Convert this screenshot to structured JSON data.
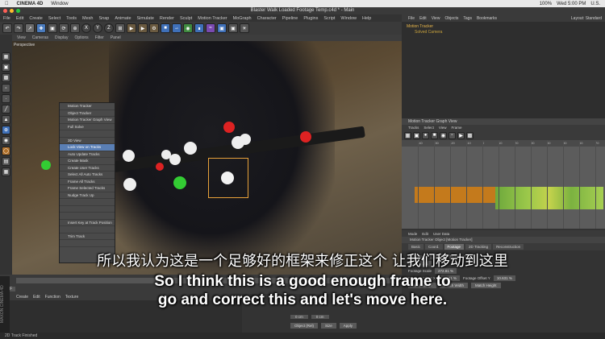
{
  "mac_menubar": {
    "app": "CINEMA 4D",
    "window_menu": "Window",
    "status_right": "100%",
    "datetime": "Wed 5:00 PM",
    "user": "U.S."
  },
  "window_title": "Blaster Walk Loaded Footage Temp.c4d * - Main",
  "menubar": [
    "File",
    "Edit",
    "Create",
    "Select",
    "Tools",
    "Mesh",
    "Snap",
    "Animate",
    "Simulate",
    "Render",
    "Sculpt",
    "Motion Tracker",
    "MoGraph",
    "Character",
    "Pipeline",
    "Plugins",
    "Script",
    "Window",
    "Help"
  ],
  "toolbar": {
    "axis_x": "X",
    "axis_y": "Y",
    "axis_z": "Z"
  },
  "viewport": {
    "menu": [
      "View",
      "Cameras",
      "Display",
      "Options",
      "Filter",
      "Panel"
    ],
    "label": "Perspective"
  },
  "context_menu": [
    {
      "label": "Motion Tracker",
      "state": "normal"
    },
    {
      "label": "Object Tracker",
      "state": "normal"
    },
    {
      "label": "Motion Tracker Graph View",
      "state": "normal"
    },
    {
      "label": "Full Solve",
      "state": "normal"
    },
    {
      "label": "",
      "state": "normal"
    },
    {
      "label": "3D View",
      "state": "normal"
    },
    {
      "label": "Lock View on Tracks",
      "state": "highlight"
    },
    {
      "label": "Auto Update Tracks",
      "state": "normal"
    },
    {
      "label": "Create Mask",
      "state": "normal"
    },
    {
      "label": "Create User Tracks",
      "state": "normal"
    },
    {
      "label": "Select All Auto Tracks",
      "state": "normal"
    },
    {
      "label": "Frame All Tracks",
      "state": "normal"
    },
    {
      "label": "Frame Selected Tracks",
      "state": "normal"
    },
    {
      "label": "Nudge Track Up",
      "state": "normal"
    },
    {
      "label": "",
      "state": "disabled"
    },
    {
      "label": "",
      "state": "disabled"
    },
    {
      "label": "",
      "state": "disabled"
    },
    {
      "label": "Insert Key at Track Position",
      "state": "normal"
    },
    {
      "label": "",
      "state": "normal"
    },
    {
      "label": "Trim Track",
      "state": "normal"
    },
    {
      "label": "",
      "state": "disabled"
    }
  ],
  "objects_panel": {
    "menu": [
      "File",
      "Edit",
      "View",
      "Objects",
      "Tags",
      "Bookmarks"
    ],
    "items": [
      {
        "name": "Motion Tracker",
        "level": 0
      },
      {
        "name": "Solved Camera",
        "level": 1
      }
    ],
    "layout_label": "Layout:",
    "layout_value": "Standard"
  },
  "graph_view": {
    "title": "Motion Tracker Graph View",
    "menu": [
      "Tracks",
      "Select",
      "View",
      "Frame"
    ],
    "ruler": [
      "-40",
      "-30",
      "-20",
      "-10",
      "0",
      "10",
      "20",
      "30",
      "40",
      "50",
      "60",
      "70"
    ]
  },
  "attributes": {
    "menu": [
      "Mode",
      "Edit",
      "User Data"
    ],
    "title": "Motion Tracker Object [Motion Tracker]",
    "tabs": [
      "Basic",
      "Coord.",
      "Footage",
      "2D Tracking",
      "Reconstruction"
    ],
    "active_tab": "Footage",
    "rows": [
      {
        "label": "Film Aspect",
        "value": "1.778",
        "extra": "(Render: 1.778)"
      },
      {
        "label": "Start",
        "value": "201"
      },
      {
        "label": "Footage Scale",
        "value": "272.81 %"
      },
      {
        "label": "Footage Offset X",
        "value": "-0.101 %",
        "label2": "Footage Offset Y",
        "value2": "10.631 %"
      }
    ],
    "buttons": [
      "Full Footage",
      "Match Width",
      "Match Height"
    ]
  },
  "timeline": {
    "frame": "0 F"
  },
  "material_menu": [
    "Create",
    "Edit",
    "Function",
    "Texture"
  ],
  "coord_panel": {
    "mode": "Object (Rel)",
    "size": "Size",
    "apply": "Apply",
    "x_val": "0 cm",
    "y_val": "0 cm"
  },
  "status_bar": "2D Track Finished",
  "brand_sidebar": "MAXON CINEMA 4D",
  "subtitles": {
    "zh": "所以我认为这是一个足够好的框架来修正这个 让我们移动到这里",
    "en_line1": "So I think this is a good enough frame to",
    "en_line2": "go and correct this and let's move here."
  }
}
